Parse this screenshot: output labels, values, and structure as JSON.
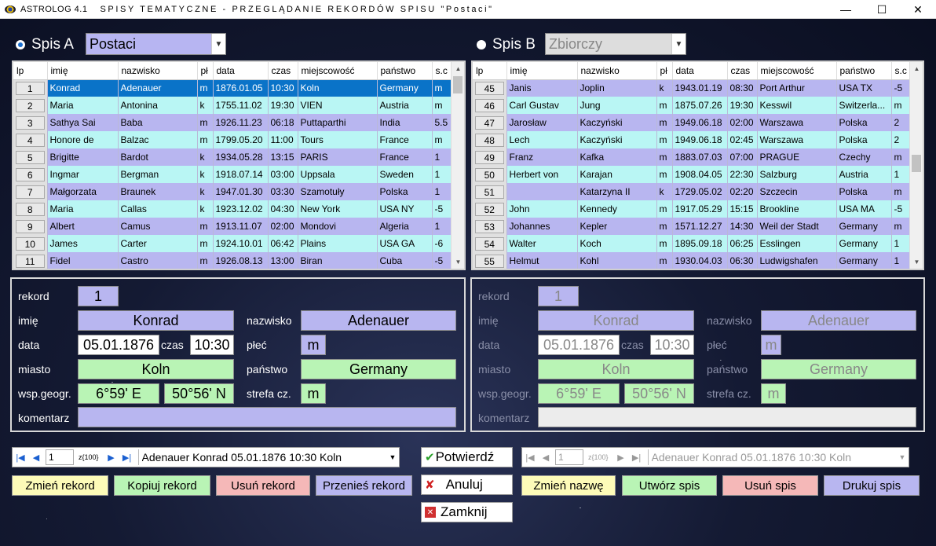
{
  "title": {
    "app": "ASTROLOG 4.1",
    "subtitle": "SPISY TEMATYCZNE - PRZEGLĄDANIE REKORDÓW SPISU \"Postaci\""
  },
  "window": {
    "minimize": "—",
    "maximize": "☐",
    "close": "✕"
  },
  "spisA": {
    "label": "Spis A",
    "list": "Postaci",
    "columns": [
      "lp",
      "imię",
      "nazwisko",
      "pł",
      "data",
      "czas",
      "miejscowość",
      "państwo",
      "s.c"
    ],
    "rows": [
      [
        "1",
        "Konrad",
        "Adenauer",
        "m",
        "1876.01.05",
        "10:30",
        "Koln",
        "Germany",
        "m"
      ],
      [
        "2",
        "Maria",
        "Antonina",
        "k",
        "1755.11.02",
        "19:30",
        "VIEN",
        "Austria",
        "m"
      ],
      [
        "3",
        "Sathya Sai",
        "Baba",
        "m",
        "1926.11.23",
        "06:18",
        "Puttaparthi",
        "India",
        "5.5"
      ],
      [
        "4",
        "Honore de",
        "Balzac",
        "m",
        "1799.05.20",
        "11:00",
        "Tours",
        "France",
        "m"
      ],
      [
        "5",
        "Brigitte",
        "Bardot",
        "k",
        "1934.05.28",
        "13:15",
        "PARIS",
        "France",
        "1"
      ],
      [
        "6",
        "Ingmar",
        "Bergman",
        "k",
        "1918.07.14",
        "03:00",
        "Uppsala",
        "Sweden",
        "1"
      ],
      [
        "7",
        "Małgorzata",
        "Braunek",
        "k",
        "1947.01.30",
        "03:30",
        "Szamotuły",
        "Polska",
        "1"
      ],
      [
        "8",
        "Maria",
        "Callas",
        "k",
        "1923.12.02",
        "04:30",
        "New York",
        "USA NY",
        "-5"
      ],
      [
        "9",
        "Albert",
        "Camus",
        "m",
        "1913.11.07",
        "02:00",
        "Mondovi",
        "Algeria",
        "1"
      ],
      [
        "10",
        "James",
        "Carter",
        "m",
        "1924.10.01",
        "06:42",
        "Plains",
        "USA GA",
        "-6"
      ],
      [
        "11",
        "Fidel",
        "Castro",
        "m",
        "1926.08.13",
        "13:00",
        "Biran",
        "Cuba",
        "-5"
      ]
    ]
  },
  "spisB": {
    "label": "Spis B",
    "list": "Zbiorczy",
    "columns": [
      "lp",
      "imię",
      "nazwisko",
      "pł",
      "data",
      "czas",
      "miejscowość",
      "państwo",
      "s.c"
    ],
    "rows": [
      [
        "45",
        "Janis",
        "Joplin",
        "k",
        "1943.01.19",
        "08:30",
        "Port Arthur",
        "USA TX",
        "-5"
      ],
      [
        "46",
        "Carl Gustav",
        "Jung",
        "m",
        "1875.07.26",
        "19:30",
        "Kesswil",
        "Switzerla...",
        "m"
      ],
      [
        "47",
        "Jarosław",
        "Kaczyński",
        "m",
        "1949.06.18",
        "02:00",
        "Warszawa",
        "Polska",
        "2"
      ],
      [
        "48",
        "Lech",
        "Kaczyński",
        "m",
        "1949.06.18",
        "02:45",
        "Warszawa",
        "Polska",
        "2"
      ],
      [
        "49",
        "Franz",
        "Kafka",
        "m",
        "1883.07.03",
        "07:00",
        "PRAGUE",
        "Czechy",
        "m"
      ],
      [
        "50",
        "Herbert von",
        "Karajan",
        "m",
        "1908.04.05",
        "22:30",
        "Salzburg",
        "Austria",
        "1"
      ],
      [
        "51",
        "",
        "Katarzyna II",
        "k",
        "1729.05.02",
        "02:20",
        "Szczecin",
        "Polska",
        "m"
      ],
      [
        "52",
        "John",
        "Kennedy",
        "m",
        "1917.05.29",
        "15:15",
        "Brookline",
        "USA MA",
        "-5"
      ],
      [
        "53",
        "Johannes",
        "Kepler",
        "m",
        "1571.12.27",
        "14:30",
        "Weil der Stadt",
        "Germany",
        "m"
      ],
      [
        "54",
        "Walter",
        "Koch",
        "m",
        "1895.09.18",
        "06:25",
        "Esslingen",
        "Germany",
        "1"
      ],
      [
        "55",
        "Helmut",
        "Kohl",
        "m",
        "1930.04.03",
        "06:30",
        "Ludwigshafen",
        "Germany",
        "1"
      ]
    ]
  },
  "form": {
    "labels": {
      "rekord": "rekord",
      "imie": "imię",
      "nazwisko": "nazwisko",
      "data": "data",
      "czas": "czas",
      "plec": "płeć",
      "miasto": "miasto",
      "panstwo": "państwo",
      "wsp": "wsp.geogr.",
      "strefa": "strefa cz.",
      "komentarz": "komentarz"
    },
    "a": {
      "rekord": "1",
      "imie": "Konrad",
      "nazwisko": "Adenauer",
      "data": "05.01.1876",
      "czas": "10:30",
      "plec": "m",
      "miasto": "Koln",
      "panstwo": "Germany",
      "lon": "6°59' E",
      "lat": "50°56' N",
      "strefa": "m",
      "komentarz": ""
    },
    "b": {
      "rekord": "1",
      "imie": "Konrad",
      "nazwisko": "Adenauer",
      "data": "05.01.1876",
      "czas": "10:30",
      "plec": "m",
      "miasto": "Koln",
      "panstwo": "Germany",
      "lon": "6°59' E",
      "lat": "50°56' N",
      "strefa": "m",
      "komentarz": ""
    }
  },
  "navA": {
    "page": "1",
    "of": "z{100}",
    "record": "Adenauer  Konrad  05.01.1876  10:30  Koln"
  },
  "navB": {
    "page": "1",
    "of": "z{100}",
    "record": "Adenauer  Konrad  05.01.1876  10:30  Koln"
  },
  "buttons": {
    "zmien_rekord": "Zmień rekord",
    "kopiuj_rekord": "Kopiuj rekord",
    "usun_rekord": "Usuń rekord",
    "przenies_rekord": "Przenieś rekord",
    "potwierdz": "Potwierdź",
    "anuluj": "Anuluj",
    "zamknij": "Zamknij",
    "zmien_nazwe": "Zmień nazwę",
    "utworz_spis": "Utwórz spis",
    "usun_spis": "Usuń spis",
    "drukuj_spis": "Drukuj spis"
  }
}
